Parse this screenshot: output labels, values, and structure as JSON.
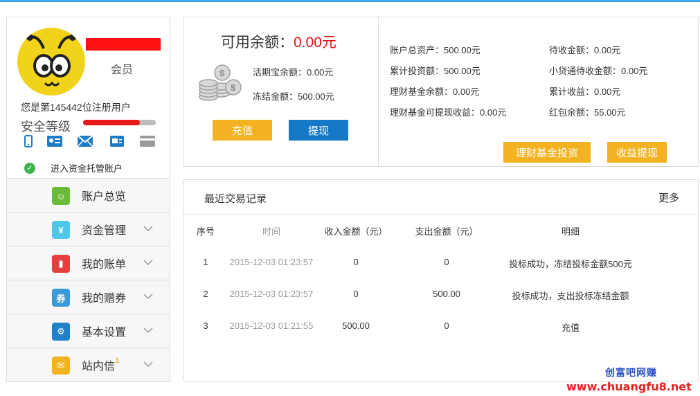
{
  "profile": {
    "role": "会员",
    "register_text": "您是第145442位注册用户",
    "security_label": "安全等级",
    "security_level": 0.78,
    "escrow_text": "进入资金托管账户"
  },
  "verify_icons": [
    "phone-icon",
    "id-card-icon",
    "email-icon",
    "bank-account-icon",
    "card-icon"
  ],
  "menu": [
    {
      "name": "account-overview",
      "label": "账户总览",
      "icon": "user-icon",
      "color": "#6bbb3a",
      "glyph": "☺",
      "chevron": false
    },
    {
      "name": "fund-management",
      "label": "资金管理",
      "icon": "yen-icon",
      "color": "#4fc7e8",
      "glyph": "¥",
      "chevron": true
    },
    {
      "name": "my-bills",
      "label": "我的账单",
      "icon": "chart-icon",
      "color": "#e0403f",
      "glyph": "▮",
      "chevron": true
    },
    {
      "name": "my-coupons",
      "label": "我的赠券",
      "icon": "coupon-icon",
      "color": "#3c9ad8",
      "glyph": "券",
      "chevron": true
    },
    {
      "name": "basic-settings",
      "label": "基本设置",
      "icon": "gear-icon",
      "color": "#2180c8",
      "glyph": "⚙",
      "chevron": true
    },
    {
      "name": "site-messages",
      "label": "站内信",
      "badge": "1",
      "icon": "envelope-icon",
      "color": "#f3b320",
      "glyph": "✉",
      "chevron": true
    }
  ],
  "balance": {
    "available_label": "可用余额：",
    "available_value": "0.00元",
    "huoqibao": "活期宝余额：0.00元",
    "frozen": "冻结金额：500.00元",
    "recharge": "充值",
    "withdraw": "提现"
  },
  "stats": {
    "total_assets": "账户总资产：500.00元",
    "total_invest": "累计投资额：500.00元",
    "fund_balance": "理财基金余额：0.00元",
    "fund_withdrawable": "理财基金可提现收益：0.00元",
    "pending": "待收金额：0.00元",
    "xiaodai": "小贷通待收金额：0.00元",
    "income": "累计收益：0.00元",
    "redpacket": "红包余额：55.00元",
    "fund_invest_btn": "理财基金投资",
    "income_withdraw_btn": "收益提现"
  },
  "transactions": {
    "title": "最近交易记录",
    "more": "更多",
    "headers": [
      "序号",
      "时间",
      "收入金额（元）",
      "支出金额（元）",
      "明细"
    ],
    "rows": [
      [
        "1",
        "2015-12-03 01:23:57",
        "0",
        "0",
        "投标成功，冻结投标金额500元"
      ],
      [
        "2",
        "2015-12-03 01:23:57",
        "0",
        "500.00",
        "投标成功，支出投标冻结金额"
      ],
      [
        "3",
        "2015-12-03 01:21:55",
        "500.00",
        "0",
        "充值"
      ]
    ]
  },
  "watermark": {
    "line1": "创富吧网赚",
    "line2": "www.chuangfu8.net"
  }
}
